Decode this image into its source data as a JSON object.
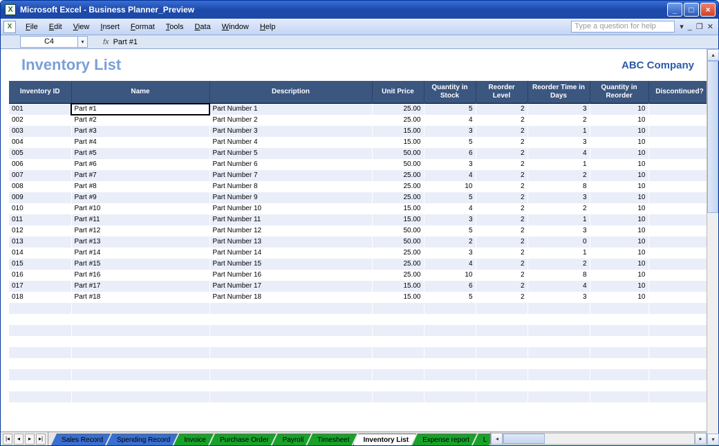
{
  "window": {
    "title": "Microsoft Excel - Business Planner_Preview"
  },
  "menubar": {
    "items": [
      "File",
      "Edit",
      "View",
      "Insert",
      "Format",
      "Tools",
      "Data",
      "Window",
      "Help"
    ],
    "help_placeholder": "Type a question for help"
  },
  "fxbar": {
    "cell_ref": "C4",
    "fx_label": "fx",
    "value": "Part #1"
  },
  "sheet": {
    "title": "Inventory List",
    "company": "ABC Company",
    "columns": [
      "Inventory ID",
      "Name",
      "Description",
      "Unit Price",
      "Quantity in Stock",
      "Reorder Level",
      "Reorder Time in Days",
      "Quantity in Reorder",
      "Discontinued?"
    ],
    "rows": [
      {
        "id": "001",
        "name": "Part #1",
        "desc": "Part Number 1",
        "price": "25.00",
        "stock": "5",
        "rlevel": "2",
        "rdays": "3",
        "rqty": "10",
        "disc": ""
      },
      {
        "id": "002",
        "name": "Part #2",
        "desc": "Part Number 2",
        "price": "25.00",
        "stock": "4",
        "rlevel": "2",
        "rdays": "2",
        "rqty": "10",
        "disc": ""
      },
      {
        "id": "003",
        "name": "Part #3",
        "desc": "Part Number 3",
        "price": "15.00",
        "stock": "3",
        "rlevel": "2",
        "rdays": "1",
        "rqty": "10",
        "disc": ""
      },
      {
        "id": "004",
        "name": "Part #4",
        "desc": "Part Number 4",
        "price": "15.00",
        "stock": "5",
        "rlevel": "2",
        "rdays": "3",
        "rqty": "10",
        "disc": ""
      },
      {
        "id": "005",
        "name": "Part #5",
        "desc": "Part Number 5",
        "price": "50.00",
        "stock": "6",
        "rlevel": "2",
        "rdays": "4",
        "rqty": "10",
        "disc": ""
      },
      {
        "id": "006",
        "name": "Part #6",
        "desc": "Part Number 6",
        "price": "50.00",
        "stock": "3",
        "rlevel": "2",
        "rdays": "1",
        "rqty": "10",
        "disc": ""
      },
      {
        "id": "007",
        "name": "Part #7",
        "desc": "Part Number 7",
        "price": "25.00",
        "stock": "4",
        "rlevel": "2",
        "rdays": "2",
        "rqty": "10",
        "disc": ""
      },
      {
        "id": "008",
        "name": "Part #8",
        "desc": "Part Number 8",
        "price": "25.00",
        "stock": "10",
        "rlevel": "2",
        "rdays": "8",
        "rqty": "10",
        "disc": ""
      },
      {
        "id": "009",
        "name": "Part #9",
        "desc": "Part Number 9",
        "price": "25.00",
        "stock": "5",
        "rlevel": "2",
        "rdays": "3",
        "rqty": "10",
        "disc": ""
      },
      {
        "id": "010",
        "name": "Part #10",
        "desc": "Part Number 10",
        "price": "15.00",
        "stock": "4",
        "rlevel": "2",
        "rdays": "2",
        "rqty": "10",
        "disc": ""
      },
      {
        "id": "011",
        "name": "Part #11",
        "desc": "Part Number 11",
        "price": "15.00",
        "stock": "3",
        "rlevel": "2",
        "rdays": "1",
        "rqty": "10",
        "disc": ""
      },
      {
        "id": "012",
        "name": "Part #12",
        "desc": "Part Number 12",
        "price": "50.00",
        "stock": "5",
        "rlevel": "2",
        "rdays": "3",
        "rqty": "10",
        "disc": ""
      },
      {
        "id": "013",
        "name": "Part #13",
        "desc": "Part Number 13",
        "price": "50.00",
        "stock": "2",
        "rlevel": "2",
        "rdays": "0",
        "rqty": "10",
        "disc": ""
      },
      {
        "id": "014",
        "name": "Part #14",
        "desc": "Part Number 14",
        "price": "25.00",
        "stock": "3",
        "rlevel": "2",
        "rdays": "1",
        "rqty": "10",
        "disc": ""
      },
      {
        "id": "015",
        "name": "Part #15",
        "desc": "Part Number 15",
        "price": "25.00",
        "stock": "4",
        "rlevel": "2",
        "rdays": "2",
        "rqty": "10",
        "disc": ""
      },
      {
        "id": "016",
        "name": "Part #16",
        "desc": "Part Number 16",
        "price": "25.00",
        "stock": "10",
        "rlevel": "2",
        "rdays": "8",
        "rqty": "10",
        "disc": ""
      },
      {
        "id": "017",
        "name": "Part #17",
        "desc": "Part Number 17",
        "price": "15.00",
        "stock": "6",
        "rlevel": "2",
        "rdays": "4",
        "rqty": "10",
        "disc": ""
      },
      {
        "id": "018",
        "name": "Part #18",
        "desc": "Part Number 18",
        "price": "15.00",
        "stock": "5",
        "rlevel": "2",
        "rdays": "3",
        "rqty": "10",
        "disc": ""
      }
    ]
  },
  "tabs": {
    "items": [
      {
        "label": "Sales Record",
        "color": "blue"
      },
      {
        "label": "Spending Record",
        "color": "blue"
      },
      {
        "label": "Invoice",
        "color": "green"
      },
      {
        "label": "Purchase Order",
        "color": "green"
      },
      {
        "label": "Payroll",
        "color": "green"
      },
      {
        "label": "Timesheet",
        "color": "green"
      },
      {
        "label": "Inventory List",
        "color": "active"
      },
      {
        "label": "Expense report",
        "color": "green"
      },
      {
        "label": "L",
        "color": "green"
      }
    ]
  }
}
